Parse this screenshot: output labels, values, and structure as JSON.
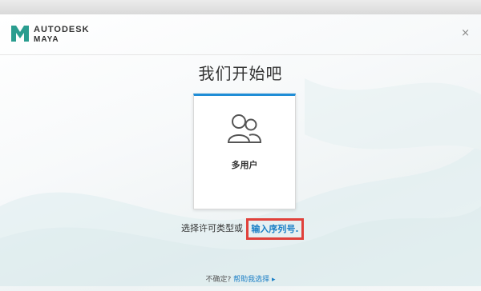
{
  "header": {
    "brand_top": "AUTODESK",
    "brand_bottom": "MAYA",
    "close_glyph": "×"
  },
  "main": {
    "title": "我们开始吧",
    "card": {
      "label": "多用户",
      "icon": "users-icon"
    },
    "select_prompt": "选择许可类型或",
    "serial_link": "输入序列号."
  },
  "footer": {
    "question": "不确定?",
    "help_link": "帮助我选择 ▸"
  },
  "colors": {
    "accent": "#1f8dd6",
    "link": "#1b7fc6",
    "highlight": "#e0413b",
    "brand": "#2a9d8f"
  }
}
